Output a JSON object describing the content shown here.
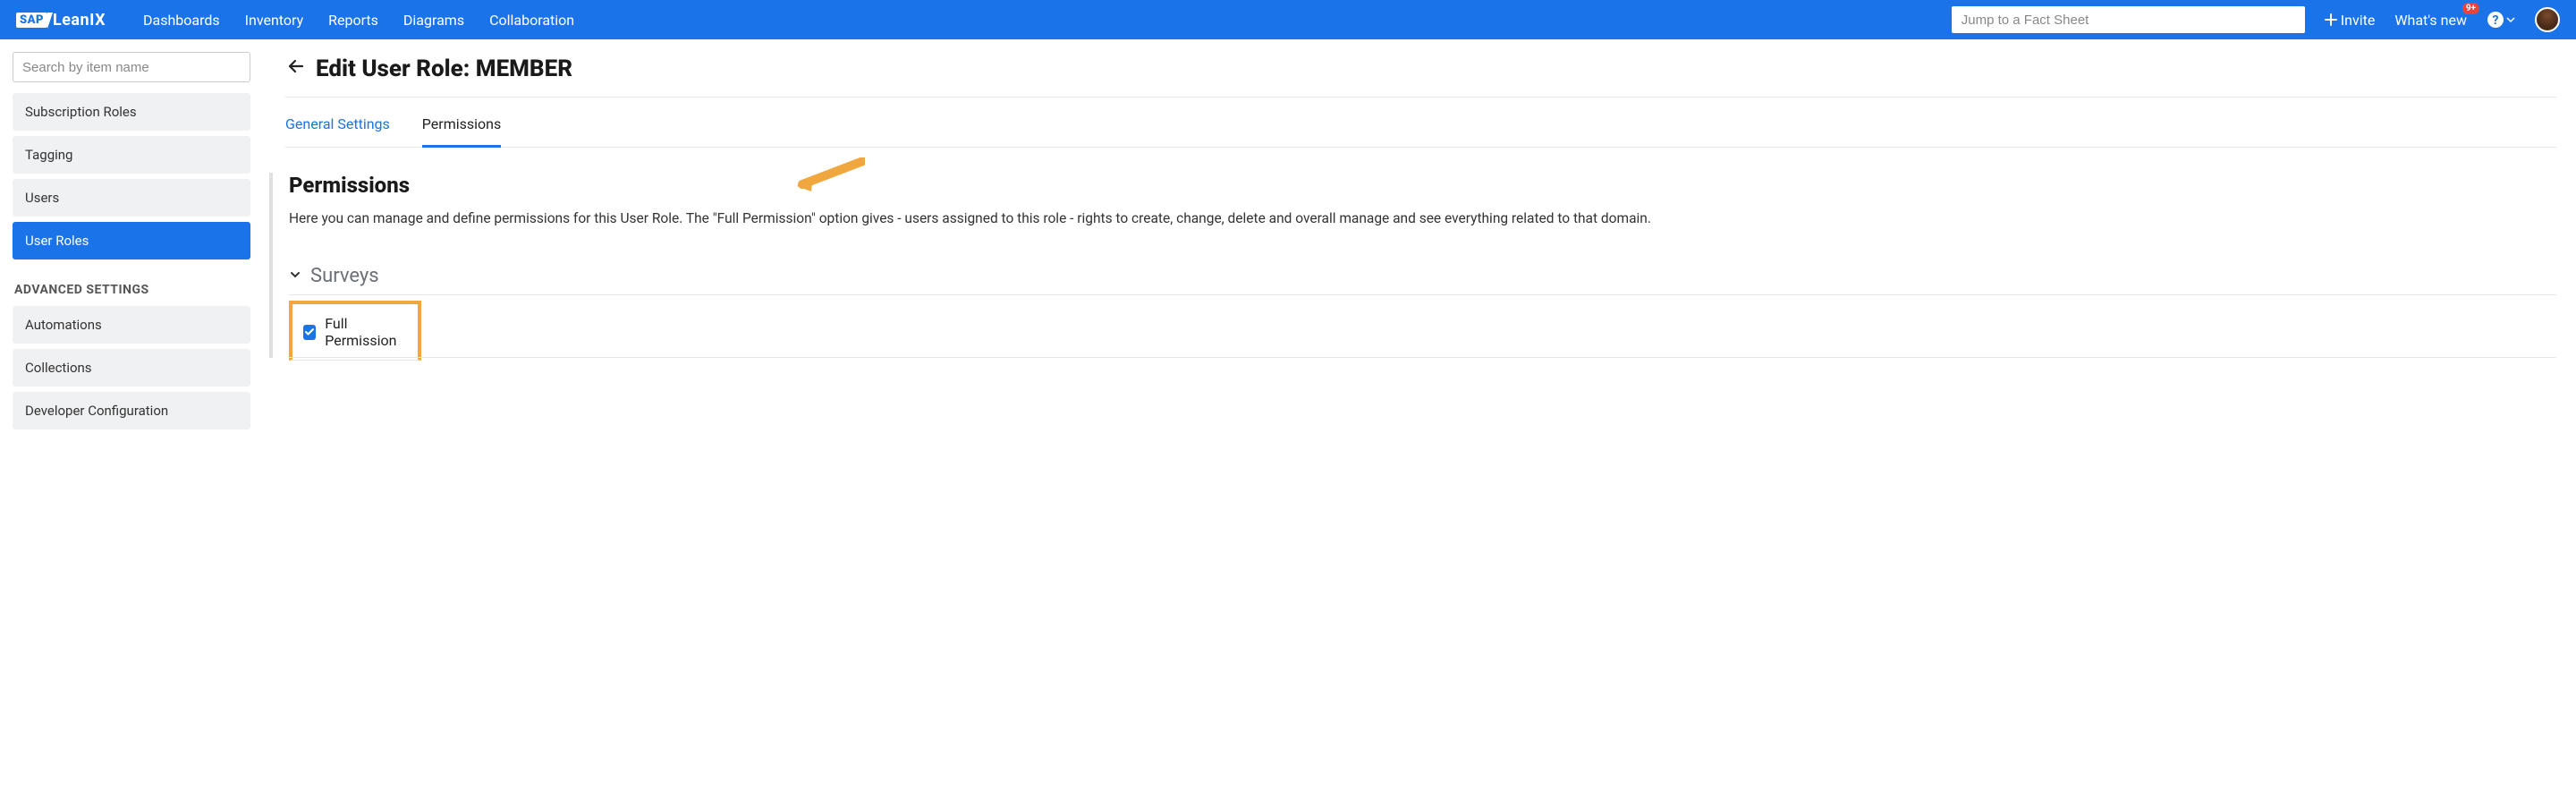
{
  "topnav": {
    "brand": {
      "sap": "SAP",
      "lean": "LeanIX"
    },
    "links": [
      "Dashboards",
      "Inventory",
      "Reports",
      "Diagrams",
      "Collaboration"
    ],
    "search_placeholder": "Jump to a Fact Sheet",
    "invite_label": "Invite",
    "whatsnew_label": "What's new",
    "notification_badge": "9+"
  },
  "sidebar": {
    "search_placeholder": "Search by item name",
    "items_top": [
      {
        "label": "Subscription Roles",
        "active": false
      },
      {
        "label": "Tagging",
        "active": false
      },
      {
        "label": "Users",
        "active": false
      },
      {
        "label": "User Roles",
        "active": true
      }
    ],
    "advanced_heading": "ADVANCED SETTINGS",
    "items_bottom": [
      {
        "label": "Automations"
      },
      {
        "label": "Collections"
      },
      {
        "label": "Developer Configuration"
      }
    ]
  },
  "main": {
    "title_prefix": "Edit User Role: ",
    "title_role": "MEMBER",
    "tabs": {
      "general": "General Settings",
      "permissions": "Permissions"
    },
    "section_title": "Permissions",
    "section_body": "Here you can manage and define permissions for this User Role. The \"Full Permission\" option gives - users assigned to this role - rights to create, change, delete and overall manage and see everything related to that domain.",
    "accordion": {
      "title": "Surveys",
      "full_permission_label": "Full Permission",
      "full_permission_checked": true
    }
  }
}
